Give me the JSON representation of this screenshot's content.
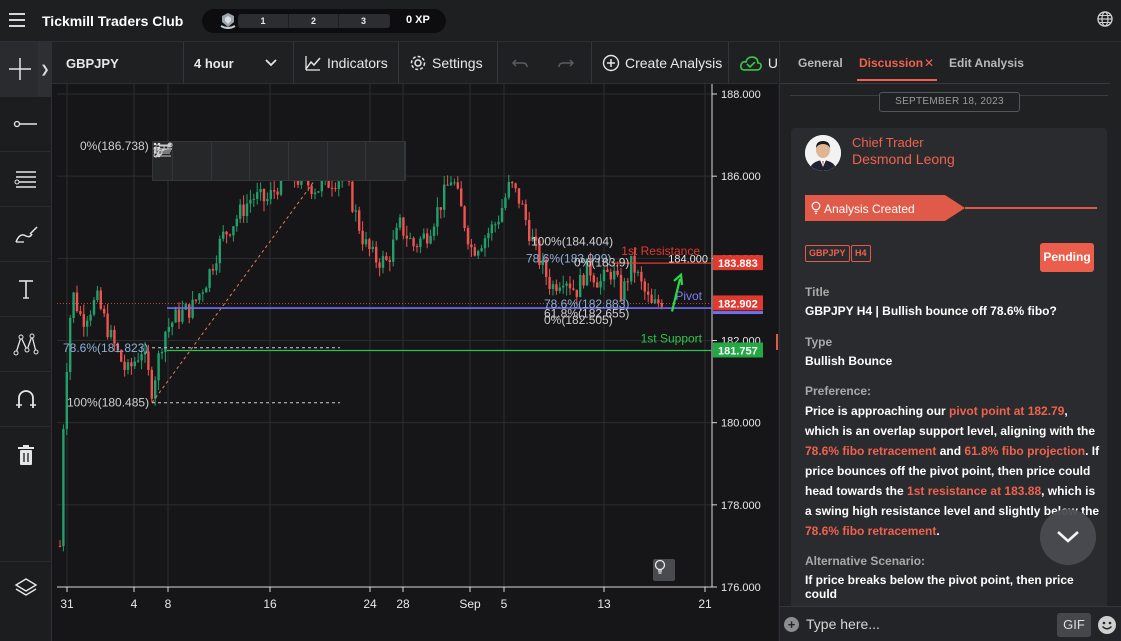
{
  "app": {
    "title": "Tickmill Traders Club",
    "xp_levels": [
      "1",
      "2",
      "3"
    ],
    "xp_value": "0 XP"
  },
  "chart_toolbar": {
    "symbol": "GBPJPY",
    "interval": "4 hour",
    "indicators_label": "Indicators",
    "settings_label": "Settings",
    "create_analysis_label": "Create Analysis",
    "cloud_label": "U"
  },
  "chart_data": {
    "type": "candlestick",
    "symbol": "GBPJPY",
    "timeframe": "4 hour",
    "y_ticks": [
      "188.000",
      "186.000",
      "184.000",
      "182.000",
      "180.000",
      "178.000",
      "176.000"
    ],
    "y_range": [
      176.0,
      188.0
    ],
    "x_ticks": [
      "31",
      "4",
      "8",
      "16",
      "24",
      "28",
      "Sep",
      "5",
      "13",
      "21"
    ],
    "price_tags": [
      {
        "label": "183.883",
        "value": 183.883,
        "color": "#e0392f"
      },
      {
        "label": "182.902",
        "value": 182.902,
        "color": "#e0392f"
      },
      {
        "label": "181.757",
        "value": 181.757,
        "color": "#23a845"
      }
    ],
    "levels": [
      {
        "name": "1st Resistance",
        "value": 183.883,
        "color": "#e0392f"
      },
      {
        "name": "Pivot",
        "value": 182.79,
        "color": "#6f6ff0"
      },
      {
        "name": "1st Support",
        "value": 181.757,
        "color": "#2ec44a"
      }
    ],
    "fib_labels": [
      "0%(186.738)",
      "78.6%(181.823)",
      "100%(180.485)",
      "100%(184.404)",
      "78.6%(183.999)",
      "0%(183.9)",
      "78.6%(182.883)",
      "61.8%(182.655)",
      "0%(182.505)"
    ],
    "extra_labels": [
      "1st Resistance",
      "Pivot",
      "1st Support",
      "184.000"
    ]
  },
  "panel": {
    "tabs": [
      "General",
      "Discussion",
      "Edit Analysis"
    ],
    "date_separator": "SEPTEMBER 18, 2023",
    "author_role": "Chief Trader",
    "author_name": "Desmond Leong",
    "banner": "Analysis Created",
    "tags": [
      "GBPJPY",
      "H4"
    ],
    "status": "Pending",
    "title_label": "Title",
    "title_value": "GBPJPY H4 | Bullish bounce off 78.6% fibo?",
    "type_label": "Type",
    "type_value": "Bullish Bounce",
    "preference_label": "Preference:",
    "preference": {
      "p1": "Price is approaching our ",
      "h1": "pivot point at 182.79",
      "p2": ", which is an overlap support level, aligning with the ",
      "h2": "78.6% fibo retracement",
      "p3": " and ",
      "h3": "61.8% fibo projection",
      "p4": ". If price bounces off the pivot point, then price could head towards the ",
      "h4": "1st resistance at 183.88",
      "p5": ", which is a swing high resistance level and slightly below the ",
      "h5": "78.6% fibo retracement",
      "p6": "."
    },
    "alternative_label": "Alternative Scenario:",
    "alternative_text": "If price breaks below the pivot point, then price could",
    "composer_placeholder": "Type here...",
    "gif_label": "GIF"
  }
}
